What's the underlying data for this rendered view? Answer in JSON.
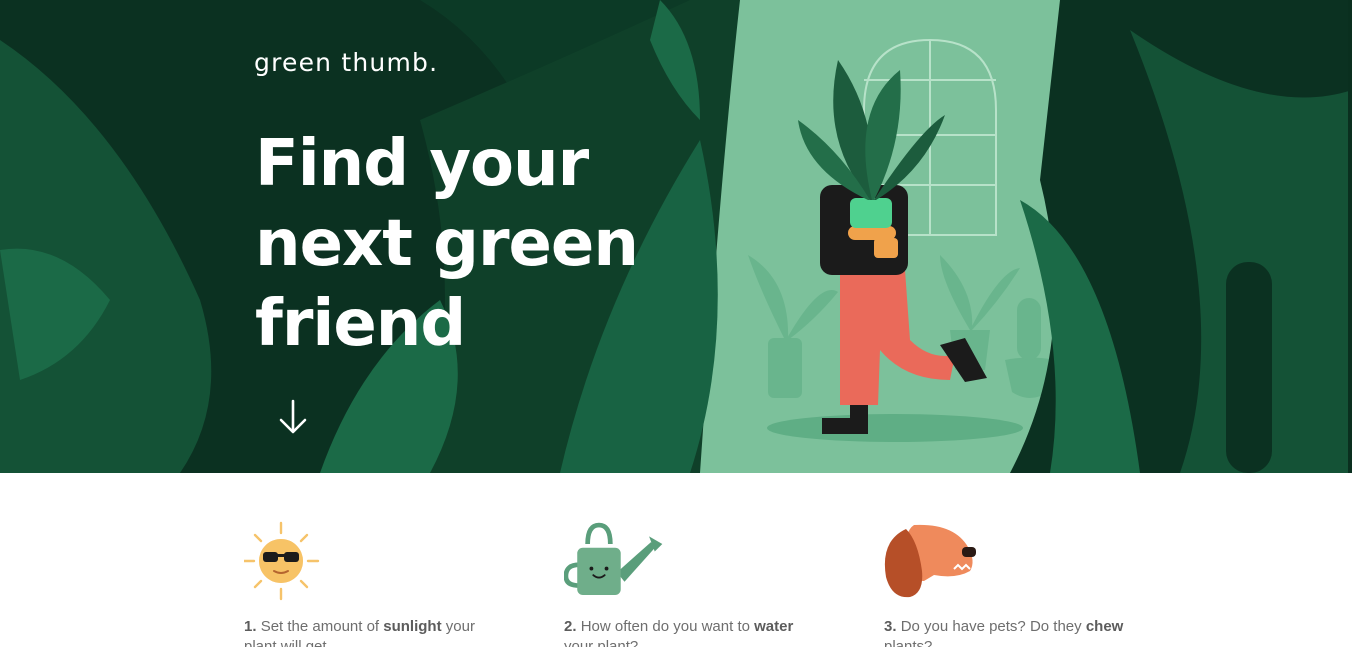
{
  "brand": {
    "logo": "green thumb."
  },
  "hero": {
    "headline_line1": "Find your",
    "headline_line2": "next green",
    "headline_line3": "friend",
    "scroll_icon": "arrow-down-icon"
  },
  "steps": [
    {
      "number": "1.",
      "text_before": "Set the amount of ",
      "bold": "sunlight",
      "text_after": " your plant will get.",
      "icon": "sun-with-sunglasses-icon"
    },
    {
      "number": "2.",
      "text_before": "How often do you want to ",
      "bold": "water",
      "text_after": " your plant?",
      "icon": "watering-can-icon"
    },
    {
      "number": "3.",
      "text_before": "Do you have pets? Do they ",
      "bold": "chew",
      "text_after": " plants?",
      "icon": "dog-icon"
    }
  ],
  "colors": {
    "hero_dark": "#0c3a26",
    "hero_light": "#7cc19b",
    "accent_coral": "#ea6a5a",
    "text_gray": "#6e6e6e"
  }
}
